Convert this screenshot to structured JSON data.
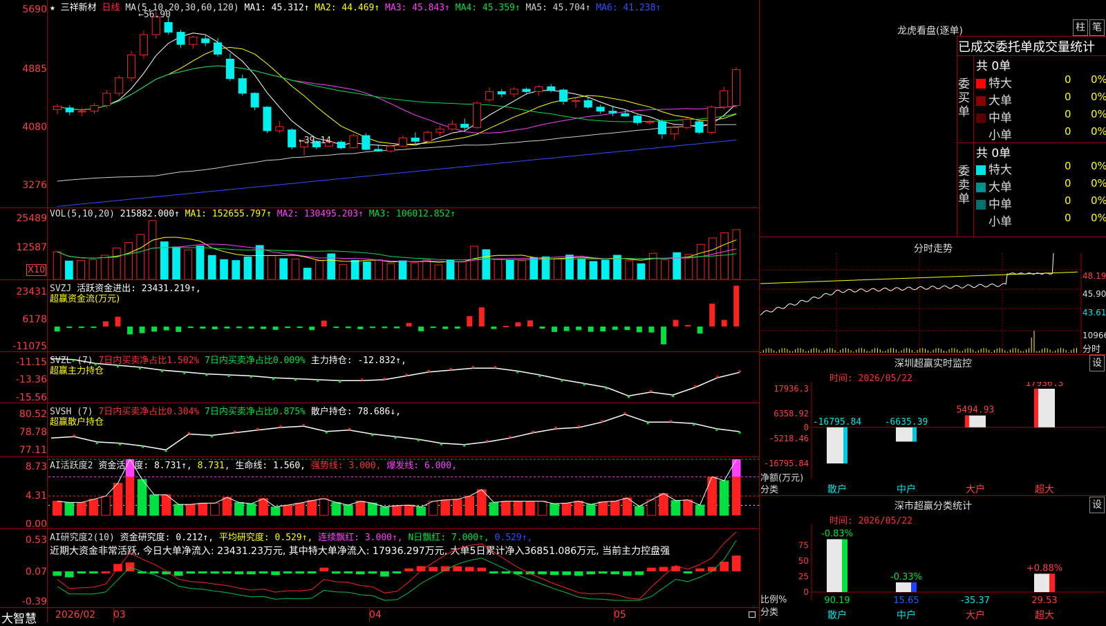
{
  "colors": {
    "up": "#ff2020",
    "down": "#00f0f0",
    "green": "#00e040",
    "grid": "#a00000",
    "axis": "#ff4040"
  },
  "header": {
    "star": "★",
    "stock": "三祥新材",
    "period": "日线",
    "ma_label": "MA(5,10,20,30,60,120)",
    "ma": [
      {
        "name": "MA1:",
        "value": "45.312↑",
        "color": "#ffffff"
      },
      {
        "name": "MA2:",
        "value": "44.469↑",
        "color": "#ffff00"
      },
      {
        "name": "MA3:",
        "value": "45.843↑",
        "color": "#ff40ff"
      },
      {
        "name": "MA4:",
        "value": "45.359↑",
        "color": "#00e040"
      },
      {
        "name": "MA5:",
        "value": "45.704↑",
        "color": "#cfcfcf"
      },
      {
        "name": "MA6:",
        "value": "41.238↑",
        "color": "#3050ff"
      }
    ]
  },
  "price_axis": [
    "5690",
    "4885",
    "4080",
    "3276"
  ],
  "price_annotations": {
    "high": "56.90",
    "low": "39.14"
  },
  "vol": {
    "label": "VOL(5,10,20)",
    "value": "215882.000↑",
    "ma1": "MA1: 152655.797↑",
    "ma2": "MA2: 130495.203↑",
    "ma3": "MA3: 106012.852↑",
    "axis": [
      "25489",
      "12587"
    ],
    "unit": "X10"
  },
  "svzj": {
    "label": "SVZJ",
    "desc": "活跃资金进出: 23431.219↑,",
    "sub": "超赢资金流(万元)",
    "axis": [
      "23431",
      "6178",
      "-11075"
    ]
  },
  "svzl": {
    "label": "SVZL (7)",
    "a": "7日内买卖净占比1.502%",
    "b": "7日内买卖净占比0.009%",
    "c": "主力持仓: -12.832↑,",
    "sub": "超赢主力持仓",
    "axis": [
      "-11.15",
      "-13.36",
      "-15.56"
    ]
  },
  "svsh": {
    "label": "SVSH (7)",
    "a": "7日内买卖净占比0.304%",
    "b": "7日内买卖净占比0.875%",
    "c": "散户持仓: 78.686↓,",
    "sub": "超赢散户持仓",
    "axis": [
      "80.52",
      "78.78",
      "77.11"
    ]
  },
  "ai1": {
    "label": "AI活跃度2",
    "a": "资金活跃度: 8.731↑,",
    "b": "8.731,",
    "c": "生命线: 1.560,",
    "d": "强势线: 3.000,",
    "e": "爆发线: 6.000,",
    "axis": [
      "8.73",
      "4.31",
      "0.00"
    ]
  },
  "ai2": {
    "label": "AI研究度2(10)",
    "a": "资金研究度: 0.212↑,",
    "b": "平均研究度: 0.529↑,",
    "c": "连续飘红: 3.000↑,",
    "d": "N日飘红: 7.000↑,",
    "e": "0.529↑,",
    "axis": [
      "0.53",
      "0.07",
      "-0.39"
    ],
    "comment": "近期大资金非常活跃, 今日大单净流入: 23431.23万元, 其中特大单净流入: 17936.297万元, 大单5日累计净入36851.086万元, 当前主力控盘强"
  },
  "timeline": [
    "2026/02",
    "03",
    "04",
    "05"
  ],
  "brand": "大智慧",
  "dragon": {
    "title": "龙虎看盘(逐单)",
    "btn1": "柱",
    "btn2": "笔",
    "subtitle": "已成交委托单成交量统计",
    "buy": {
      "side": "委买单",
      "total": "共 0单",
      "rows": [
        {
          "name": "特大",
          "count": "0",
          "pct": "0%",
          "color": "#ff0000"
        },
        {
          "name": "大单",
          "count": "0",
          "pct": "0%",
          "color": "#8b0000"
        },
        {
          "name": "中单",
          "count": "0",
          "pct": "0%",
          "color": "#5a0000"
        },
        {
          "name": "小单",
          "count": "0",
          "pct": "0%",
          "color": ""
        }
      ]
    },
    "sell": {
      "side": "委卖单",
      "total": "共 0单",
      "rows": [
        {
          "name": "特大",
          "count": "0",
          "pct": "0%",
          "color": "#00e5e5"
        },
        {
          "name": "大单",
          "count": "0",
          "pct": "0%",
          "color": "#009090"
        },
        {
          "name": "中单",
          "count": "0",
          "pct": "0%",
          "color": "#007070"
        },
        {
          "name": "小单",
          "count": "0",
          "pct": "0%",
          "color": ""
        }
      ]
    }
  },
  "intraday": {
    "title": "分时走势",
    "axis": [
      "48.19",
      "45.90",
      "43.61",
      "10966"
    ],
    "unit": "分时"
  },
  "monitor": {
    "title": "深圳超赢实时监控",
    "set": "设",
    "date": "时间: 2026/05/22",
    "axis": [
      "17936.3",
      "6358.92",
      "0",
      "-5218.46",
      "-16795.84"
    ],
    "bars": [
      {
        "cat": "散户",
        "value": "-16795.84"
      },
      {
        "cat": "中户",
        "value": "-6635.39"
      },
      {
        "cat": "大户",
        "value": "5494.93"
      },
      {
        "cat": "超大",
        "value": "17936.3"
      }
    ],
    "ylabel": "净额(万元)",
    "xlabel": "分类"
  },
  "classify": {
    "title": "深市超赢分类统计",
    "set": "设",
    "date": "时间: 2026/05/22",
    "axis": [
      "75",
      "50",
      "25",
      "0"
    ],
    "bars": [
      {
        "cat": "散户",
        "ratio": "90.19",
        "chg": "-0.83%"
      },
      {
        "cat": "中户",
        "ratio": "15.65",
        "chg": "-0.33%"
      },
      {
        "cat": "大户",
        "ratio": "-35.37",
        "chg": ""
      },
      {
        "cat": "超大",
        "ratio": "29.53",
        "chg": "+0.88%"
      }
    ],
    "ylabel": "比例%",
    "xlabel": "分类"
  },
  "chart_data": [
    {
      "type": "candlestick",
      "title": "三祥新材 日线",
      "ylim": [
        32.76,
        56.9
      ],
      "ohlc": [
        [
          44.8,
          45.5,
          44.2,
          45.2
        ],
        [
          45.0,
          45.3,
          44.1,
          44.5
        ],
        [
          44.5,
          45.0,
          44.0,
          44.6
        ],
        [
          44.6,
          45.6,
          44.3,
          45.3
        ],
        [
          45.3,
          47.2,
          45.0,
          46.8
        ],
        [
          46.8,
          49.0,
          46.5,
          48.7
        ],
        [
          48.7,
          52.0,
          48.3,
          51.5
        ],
        [
          51.5,
          54.5,
          51.0,
          54.0
        ],
        [
          54.0,
          56.9,
          53.5,
          56.2
        ],
        [
          55.5,
          56.2,
          54.0,
          54.3
        ],
        [
          54.3,
          54.6,
          52.4,
          52.8
        ],
        [
          52.8,
          53.9,
          52.3,
          53.7
        ],
        [
          53.5,
          54.0,
          52.6,
          53.0
        ],
        [
          53.0,
          53.6,
          51.3,
          51.6
        ],
        [
          51.0,
          51.7,
          48.3,
          48.6
        ],
        [
          48.6,
          49.1,
          46.5,
          46.8
        ],
        [
          46.8,
          46.9,
          44.7,
          45.1
        ],
        [
          45.1,
          45.2,
          41.9,
          42.2
        ],
        [
          42.2,
          43.4,
          41.9,
          42.7
        ],
        [
          42.3,
          42.5,
          39.9,
          40.2
        ],
        [
          40.2,
          41.3,
          39.14,
          40.9
        ],
        [
          40.9,
          41.0,
          39.9,
          40.2
        ],
        [
          40.3,
          41.1,
          40.2,
          40.8
        ],
        [
          40.8,
          41.0,
          39.9,
          40.1
        ],
        [
          40.1,
          41.8,
          40.0,
          41.6
        ],
        [
          41.6,
          41.9,
          39.8,
          39.9
        ],
        [
          39.9,
          40.5,
          39.6,
          39.7
        ],
        [
          39.7,
          40.5,
          39.5,
          40.3
        ],
        [
          40.3,
          41.6,
          40.2,
          41.3
        ],
        [
          41.3,
          42.0,
          40.6,
          40.9
        ],
        [
          40.9,
          42.2,
          40.8,
          42.0
        ],
        [
          42.0,
          42.8,
          41.6,
          42.4
        ],
        [
          42.4,
          43.5,
          42.2,
          43.0
        ],
        [
          43.0,
          43.7,
          42.2,
          42.6
        ],
        [
          42.6,
          45.8,
          42.4,
          45.6
        ],
        [
          46.0,
          47.5,
          45.7,
          47.0
        ],
        [
          47.0,
          47.3,
          46.3,
          46.7
        ],
        [
          46.7,
          47.6,
          46.3,
          47.3
        ],
        [
          47.3,
          47.5,
          46.8,
          47.0
        ],
        [
          47.0,
          47.8,
          46.5,
          47.6
        ],
        [
          47.6,
          47.9,
          46.9,
          47.2
        ],
        [
          47.2,
          47.4,
          45.4,
          45.8
        ],
        [
          45.8,
          46.2,
          45.0,
          45.9
        ],
        [
          45.9,
          46.3,
          44.9,
          45.1
        ],
        [
          45.1,
          45.4,
          44.3,
          44.6
        ],
        [
          44.6,
          45.3,
          44.0,
          44.4
        ],
        [
          44.3,
          44.7,
          43.9,
          44.0
        ],
        [
          44.0,
          44.2,
          42.9,
          43.2
        ],
        [
          43.2,
          43.6,
          42.9,
          43.3
        ],
        [
          43.3,
          43.6,
          41.2,
          41.8
        ],
        [
          41.8,
          42.9,
          41.0,
          42.6
        ],
        [
          42.6,
          43.8,
          42.4,
          43.6
        ],
        [
          43.3,
          43.5,
          41.8,
          42.0
        ],
        [
          42.0,
          45.3,
          41.8,
          45.1
        ],
        [
          45.1,
          47.6,
          44.8,
          47.1
        ],
        [
          45.3,
          50.0,
          45.0,
          49.7
        ]
      ]
    },
    {
      "type": "bar",
      "title": "VOL(5,10,20)",
      "ylim": [
        0,
        25489
      ],
      "values": [
        12000,
        8000,
        8200,
        8600,
        10500,
        13600,
        16000,
        19500,
        25489,
        16300,
        14100,
        12800,
        14500,
        10400,
        8600,
        8200,
        9700,
        14700,
        10400,
        9000,
        8800,
        4900,
        8100,
        11100,
        6500,
        8300,
        7600,
        8500,
        6900,
        8100,
        7200,
        8600,
        6300,
        8400,
        7600,
        14400,
        12900,
        8900,
        8300,
        8100,
        9500,
        9800,
        9100,
        10600,
        9000,
        7800,
        8400,
        10500,
        8100,
        6800,
        11300,
        8500,
        11600,
        10800,
        15200,
        18000,
        20200,
        21588
      ]
    },
    {
      "type": "bar",
      "title": "SVZJ",
      "ylim": [
        -11075,
        23431
      ],
      "values": [
        -2800,
        -400,
        -300,
        -300,
        3000,
        5600,
        -4500,
        -3800,
        -2900,
        -2200,
        -3100,
        -600,
        -1200,
        -1600,
        -1100,
        -900,
        -1200,
        -1400,
        -1900,
        -700,
        -800,
        -2000,
        3400,
        -600,
        -900,
        -1500,
        -800,
        -900,
        -1000,
        2000,
        -2700,
        -600,
        -1400,
        -1200,
        6000,
        11000,
        -1400,
        400,
        2400,
        3500,
        -1200,
        -3100,
        -2600,
        -2100,
        -3000,
        -2800,
        -1900,
        -2000,
        -3300,
        -3400,
        -10200,
        3800,
        900,
        -4000,
        13100,
        3800,
        23431
      ]
    },
    {
      "type": "line",
      "title": "SVZL",
      "ylim": [
        -15.56,
        -11.15
      ],
      "values": [
        -11.4,
        -11.5,
        -11.9,
        -12.1,
        -12.3,
        -12.6,
        -12.8,
        -13.0,
        -13.1,
        -13.2,
        -13.4,
        -13.5,
        -13.6,
        -13.7,
        -13.7,
        -13.6,
        -13.2,
        -12.8,
        -12.6,
        -12.4,
        -12.4,
        -12.7,
        -13.1,
        -13.6,
        -14.0,
        -14.4,
        -15.3,
        -14.9,
        -15.2,
        -14.4,
        -13.4,
        -12.832
      ]
    },
    {
      "type": "line",
      "title": "SVSH",
      "ylim": [
        77.11,
        80.52
      ],
      "values": [
        78.2,
        78.3,
        77.9,
        77.8,
        77.6,
        77.3,
        78.5,
        78.4,
        78.6,
        78.8,
        79.0,
        79.1,
        78.7,
        78.8,
        78.5,
        78.3,
        78.1,
        77.8,
        77.7,
        77.9,
        78.2,
        78.6,
        78.9,
        79.0,
        79.4,
        80.0,
        79.4,
        79.4,
        79.3,
        78.9,
        78.686
      ]
    },
    {
      "type": "bar",
      "title": "AI活跃度2",
      "ylim": [
        0,
        8.73
      ],
      "values": [
        2.2,
        2.0,
        2.0,
        2.5,
        3.0,
        5.0,
        8.731,
        5.6,
        3.2,
        3.2,
        1.7,
        1.7,
        1.9,
        1.9,
        2.8,
        2.0,
        1.8,
        2.6,
        1.3,
        1.6,
        1.9,
        2.3,
        2.6,
        2.0,
        1.6,
        2.2,
        1.9,
        1.3,
        1.5,
        1.6,
        1.3,
        2.2,
        2.4,
        2.5,
        3.0,
        4.0,
        2.0,
        2.2,
        2.2,
        2.2,
        2.2,
        1.8,
        1.9,
        2.2,
        1.7,
        2.1,
        2.2,
        2.7,
        1.4,
        2.4,
        3.4,
        2.3,
        2.4,
        1.6,
        6.0,
        5.4,
        8.731
      ]
    },
    {
      "type": "bar",
      "title": "AI研究度2(10)",
      "ylim": [
        -0.39,
        0.53
      ],
      "values": [
        -0.06,
        -0.08,
        -0.02,
        -0.02,
        0.0,
        0.1,
        0.12,
        -0.02,
        -0.02,
        -0.04,
        -0.06,
        -0.03,
        -0.02,
        -0.03,
        -0.03,
        -0.04,
        -0.04,
        -0.02,
        -0.05,
        -0.02,
        -0.03,
        -0.02,
        0.05,
        -0.03,
        -0.02,
        -0.04,
        -0.03,
        -0.07,
        -0.02,
        0.04,
        0.07,
        0.06,
        0.07,
        0.07,
        0.06,
        0.05,
        -0.02,
        -0.03,
        -0.04,
        -0.04,
        -0.04,
        -0.05,
        -0.05,
        -0.06,
        -0.04,
        -0.03,
        -0.04,
        -0.06,
        -0.05,
        0.05,
        0.06,
        0.07,
        -0.02,
        0.04,
        0.06,
        0.13,
        0.212
      ]
    }
  ]
}
